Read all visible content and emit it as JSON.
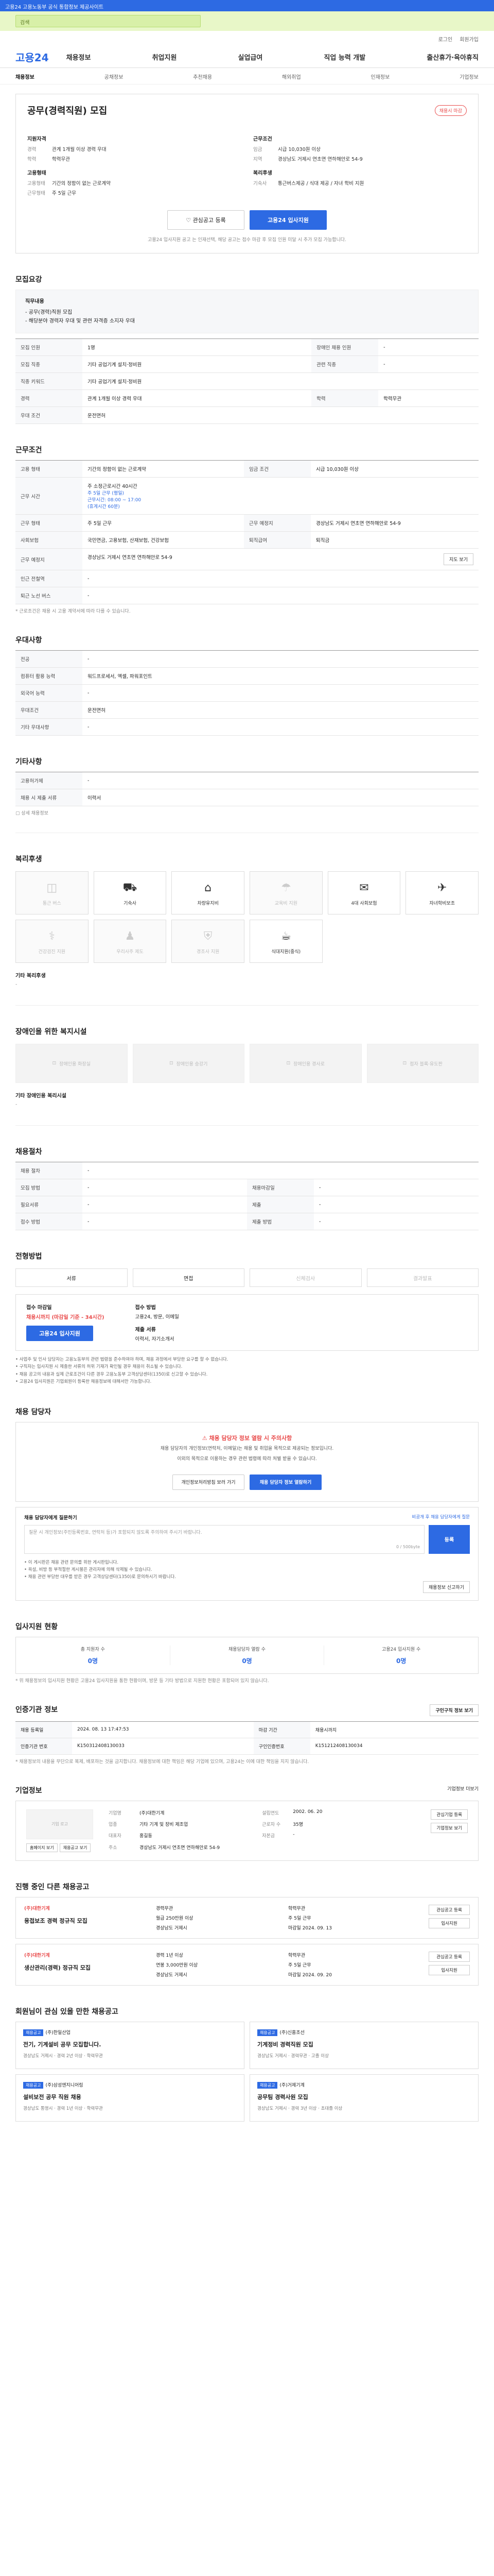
{
  "banner": {
    "text": "고용24 고용노동부 공식 통합정보 제공사이트"
  },
  "search": {
    "placeholder": "검색"
  },
  "utility": [
    "로그인",
    "회원가입"
  ],
  "gnb": {
    "logo": "고용24",
    "menu": [
      "채용정보",
      "취업지원",
      "실업급여",
      "직업 능력 개발",
      "출산휴가·육아휴직"
    ]
  },
  "lnb": [
    "채용정보",
    "공채정보",
    "추천채용",
    "해외취업",
    "인재정보",
    "기업정보"
  ],
  "job": {
    "title": "공무(경력직원) 모집",
    "badge": "채용시 마감",
    "company_h": "지원자격",
    "career_k": "경력",
    "career_v": "관계 1개월 이상 경력 우대",
    "edu_k": "학력",
    "edu_v": "학력무관",
    "form_h": "고용형태",
    "form_k1": "고용형태",
    "form_v1": "기간의 정함이 없는 근로계약",
    "form_k2": "근무형태",
    "form_v2": "주 5일 근무",
    "cond_h": "근무조건",
    "pay_k": "임금",
    "pay_v": "시급 10,030원 이상",
    "loc_k": "지역",
    "loc_v": "경상남도 거제시 연초면 연하해안로 54-9",
    "welfare_h": "복리후생",
    "welfare_k": "기숙사",
    "welfare_v": "통근버스제공 / 식대 제공 / 자녀 학비 지원"
  },
  "buttons": {
    "scrap": "관심공고 등록",
    "apply": "고용24 입사지원"
  },
  "note_top": "고용24 입사지원 공고 는 인재선택, 해당 공고는 접수 마감 후 모집 인원 미달 시 추가 모집 가능합니다.",
  "sec_recruit": "모집요강",
  "recruit_box": {
    "h": "직무내용",
    "l1": "- 공무(경력)직원 모집",
    "l2": "- 해당분야 경력자 우대 및 관련 자격증 소지자 우대"
  },
  "recruit_table": [
    [
      "모집 인원",
      "1명",
      "장애인 채용 인원",
      "-"
    ],
    [
      "모집 직종",
      "기타 공업기계 설치·정비원",
      "관련 직종",
      "-"
    ],
    [
      "직종 키워드",
      "기타 공업기계 설치·정비원",
      "-",
      "-"
    ],
    [
      "경력",
      "관계 1개월 이상 경력 우대",
      "학력",
      "학력무관"
    ],
    [
      "우대 조건",
      "운전면허",
      "-",
      "-"
    ]
  ],
  "sec_cond": "근무조건",
  "cond_table": [
    [
      "고용 형태",
      "기간의 정함이 없는 근로계약",
      "임금 조건",
      "시급 10,030원 이상"
    ],
    [
      "근무 시간",
      "주 소정근로시간 40시간",
      "",
      ""
    ],
    [
      "근무 형태",
      "주 5일 근무",
      "근무 예정지",
      "경상남도 거제시 연초면 연하해안로 54-9"
    ],
    [
      "사회보험",
      "국민연금, 고용보험, 산재보험, 건강보험",
      "퇴직급여",
      "퇴직금"
    ],
    [
      "근무 예정지",
      "경상남도 거제시 연초면 연하해안로 54-9",
      "",
      ""
    ],
    [
      "인근 전철역",
      "-",
      "",
      ""
    ],
    [
      "퇴근 노선 버스",
      "-",
      "",
      ""
    ]
  ],
  "time_detail": [
    "주 5일 근무 (평일)",
    "근무시간: 08:00 ~ 17:00",
    "(휴게시간 60분)"
  ],
  "map_btn": "지도 보기",
  "cond_note": "* 근로조건은 채용 시 고용 계약서에 따라 다를 수 있습니다.",
  "sec_qual": "우대사항",
  "qual_table": [
    [
      "전공",
      "-"
    ],
    [
      "컴퓨터 활용 능력",
      "워드프로세서, 엑셀, 파워포인트"
    ],
    [
      "외국어 능력",
      "-"
    ],
    [
      "우대조건",
      "운전면허"
    ],
    [
      "기타 우대사항",
      "-"
    ]
  ],
  "sec_other": "기타사항",
  "other_table": [
    [
      "고용허가제",
      "-"
    ],
    [
      "채용 시 제출 서류",
      "이력서"
    ]
  ],
  "other_link": "상세 채용정보",
  "sec_welfare": "복리후생",
  "welfare": [
    {
      "icon": "◫",
      "label": "통근 버스",
      "state": "off"
    },
    {
      "icon": "⛟",
      "label": "기숙사",
      "state": "active"
    },
    {
      "icon": "⌂",
      "label": "차량유지비",
      "state": "active"
    },
    {
      "icon": "☂",
      "label": "교육비 지원",
      "state": "off"
    },
    {
      "icon": "✉",
      "label": "4대 사회보험",
      "state": "active"
    },
    {
      "icon": "✈",
      "label": "자녀학비보조",
      "state": "active"
    },
    {
      "icon": "⚕",
      "label": "건강검진 지원",
      "state": "off"
    },
    {
      "icon": "♟",
      "label": "우리사주 제도",
      "state": "off"
    },
    {
      "icon": "⛨",
      "label": "경조사 지원",
      "state": "off"
    },
    {
      "icon": "☕",
      "label": "식대지원(중식)",
      "state": "active"
    }
  ],
  "welfare_etc_h": "기타 복리후생",
  "welfare_etc": "-",
  "sec_disabled": "장애인을 위한 복지시설",
  "disabled": [
    "장애인용 화장실",
    "장애인용 승강기",
    "장애인용 경사로",
    "점자 블록·유도판"
  ],
  "disabled_etc_h": "기타 장애인용 복리시설",
  "disabled_etc": "-",
  "sec_process": "채용절차",
  "process_table": [
    [
      "채용 절차",
      "-",
      "",
      ""
    ],
    [
      "모집 방법",
      "-",
      "채용마감일",
      "-"
    ],
    [
      "필요서류",
      "-",
      "제출",
      "-"
    ],
    [
      "접수 방법",
      "-",
      "제출 방법",
      "-"
    ]
  ],
  "sec_apply": "전형방법",
  "steps": [
    "서류",
    "면접",
    "신체검사",
    "결과발표"
  ],
  "apply": {
    "h1": "접수 마감일",
    "red": "채용시까지 (마감일 기준 - 34시간)",
    "h2": "접수 방법",
    "v2": "고용24, 방문, 이메일",
    "h3": "제출 서류",
    "v3": "이력서, 자기소개서",
    "btn": "고용24 입사지원"
  },
  "apply_notes": [
    "• 사업주 및 인사 담당자는 고용노동부의 관련 법령을 준수하여야 하며, 채용 과정에서 부당한 요구를 할 수 없습니다.",
    "• 구직자는 입사지원 시 제출한 서류의 허위 기재가 확인될 경우 채용이 취소될 수 있습니다.",
    "• 채용 공고의 내용과 실제 근로조건이 다른 경우 고용노동부 고객상담센터(1350)로 신고할 수 있습니다.",
    "• 고용24 입사지원은 기업회원이 등록한 채용정보에 대해서만 가능합니다."
  ],
  "sec_contact": "채용 담당자",
  "contact": {
    "warn": "채용 담당자 정보 열람 시 주의사항",
    "p1": "채용 담당자의 개인정보(연락처, 이메일)는 채용 및 취업을 목적으로 제공되는 정보입니다.",
    "p2": "이외의 목적으로 이용하는 경우 관련 법령에 따라 처벌 받을 수 있습니다.",
    "b1": "개인정보처리방침 보러 가기",
    "b2": "채용 담당자 정보 열람하기"
  },
  "inquiry": {
    "h": "채용 담당자에게 질문하기",
    "r": "비공개 후 채용 담당자에게 질문",
    "ph": "질문 시 개인정보(주민등록번호, 연락처 등)가 포함되지 않도록 주의하여 주시기 바랍니다.",
    "count": "0 / 500byte",
    "btn": "등록"
  },
  "inquiry_notes": [
    "• 이 게시판은 채용 관련 문의를 위한 게시판입니다.",
    "• 욕설, 비방 등 부적절한 게시물은 관리자에 의해 삭제될 수 있습니다.",
    "• 채용 관련 부당한 대우를 받은 경우 고객상담센터(1350)로 문의하시기 바랍니다."
  ],
  "inquiry_side": "채용정보 신고하기",
  "sec_stats": "입사지원 현황",
  "stats": [
    {
      "k": "총 지원자 수",
      "v": "0명"
    },
    {
      "k": "채용담당자 열람 수",
      "v": "0명"
    },
    {
      "k": "고용24 입사지원 수",
      "v": "0명"
    }
  ],
  "stats_note": "* 위 채용정보의 입사지원 현황은 고용24 입사지원을 통한 현황이며, 방문 등 기타 방법으로 지원한 현황은 포함되어 있지 않습니다.",
  "sec_mgmt": "인증기관 정보",
  "mgmt_btn": "구인구직 정보 보기",
  "mgmt_table": [
    [
      "채용 등록일",
      "2024. 08. 13 17:47:53",
      "마감 기간",
      "채용시까지"
    ],
    [
      "인증기관 번호",
      "K150312408130033",
      "구인인증번호",
      "K151212408130034"
    ]
  ],
  "mgmt_note": "* 채용정보의 내용을 무단으로 복제, 배포하는 것을 금지합니다. 채용정보에 대한 책임은 해당 기업에 있으며, 고용24는 이에 대한 책임을 지지 않습니다.",
  "sec_company": "기업정보",
  "company_more": "기업정보 더보기",
  "company": {
    "logo": "기업 로고",
    "rows": [
      [
        "기업명",
        "(주)대한기계",
        "설립연도",
        "2002. 06. 20"
      ],
      [
        "업종",
        "기타 기계 및 장비 제조업",
        "근로자 수",
        "35명"
      ],
      [
        "대표자",
        "홍길동",
        "자본금",
        "-"
      ],
      [
        "주소",
        "경상남도 거제시 연초면 연하해안로 54-9",
        "",
        ""
      ]
    ],
    "btns": [
      "관심기업 등록",
      "기업정보 보기"
    ],
    "subbtns": [
      "홈페이지 보기",
      "채용공고 보기"
    ]
  },
  "sec_otherjobs": "진행 중인 다른 채용공고",
  "otherjobs": [
    {
      "co": "(주)대한기계",
      "title": "용접보조 경력 정규직 모집",
      "meta": [
        "경력무관",
        "학력무관",
        "월급 250만원 이상",
        "주 5일 근무",
        "경상남도 거제시",
        "마감일 2024. 09. 13"
      ],
      "btn": [
        "관심공고 등록",
        "입사지원"
      ]
    },
    {
      "co": "(주)대한기계",
      "title": "생산관리(경력) 정규직 모집",
      "meta": [
        "경력 1년 이상",
        "학력무관",
        "연봉 3,000만원 이상",
        "주 5일 근무",
        "경상남도 거제시",
        "마감일 2024. 09. 20"
      ],
      "btn": [
        "관심공고 등록",
        "입사지원"
      ]
    }
  ],
  "sec_similar": "회원님이 관심 있을 만한 채용공고",
  "similar": [
    {
      "tag": "채용공고",
      "co": "(주)한일산업",
      "title": "전기, 기계설비 공무 모집합니다.",
      "meta": "경상남도 거제시 · 경력 2년 이상 · 학력무관"
    },
    {
      "tag": "채용공고",
      "co": "(주)신흥조선",
      "title": "기계정비 경력직원 모집",
      "meta": "경상남도 거제시 · 경력무관 · 고졸 이상"
    },
    {
      "tag": "채용공고",
      "co": "(주)삼성엔지니어링",
      "title": "설비보전 공무 직원 채용",
      "meta": "경상남도 통영시 · 경력 1년 이상 · 학력무관"
    },
    {
      "tag": "채용공고",
      "co": "(주)거제기계",
      "title": "공무팀 경력사원 모집",
      "meta": "경상남도 거제시 · 경력 3년 이상 · 초대졸 이상"
    }
  ]
}
